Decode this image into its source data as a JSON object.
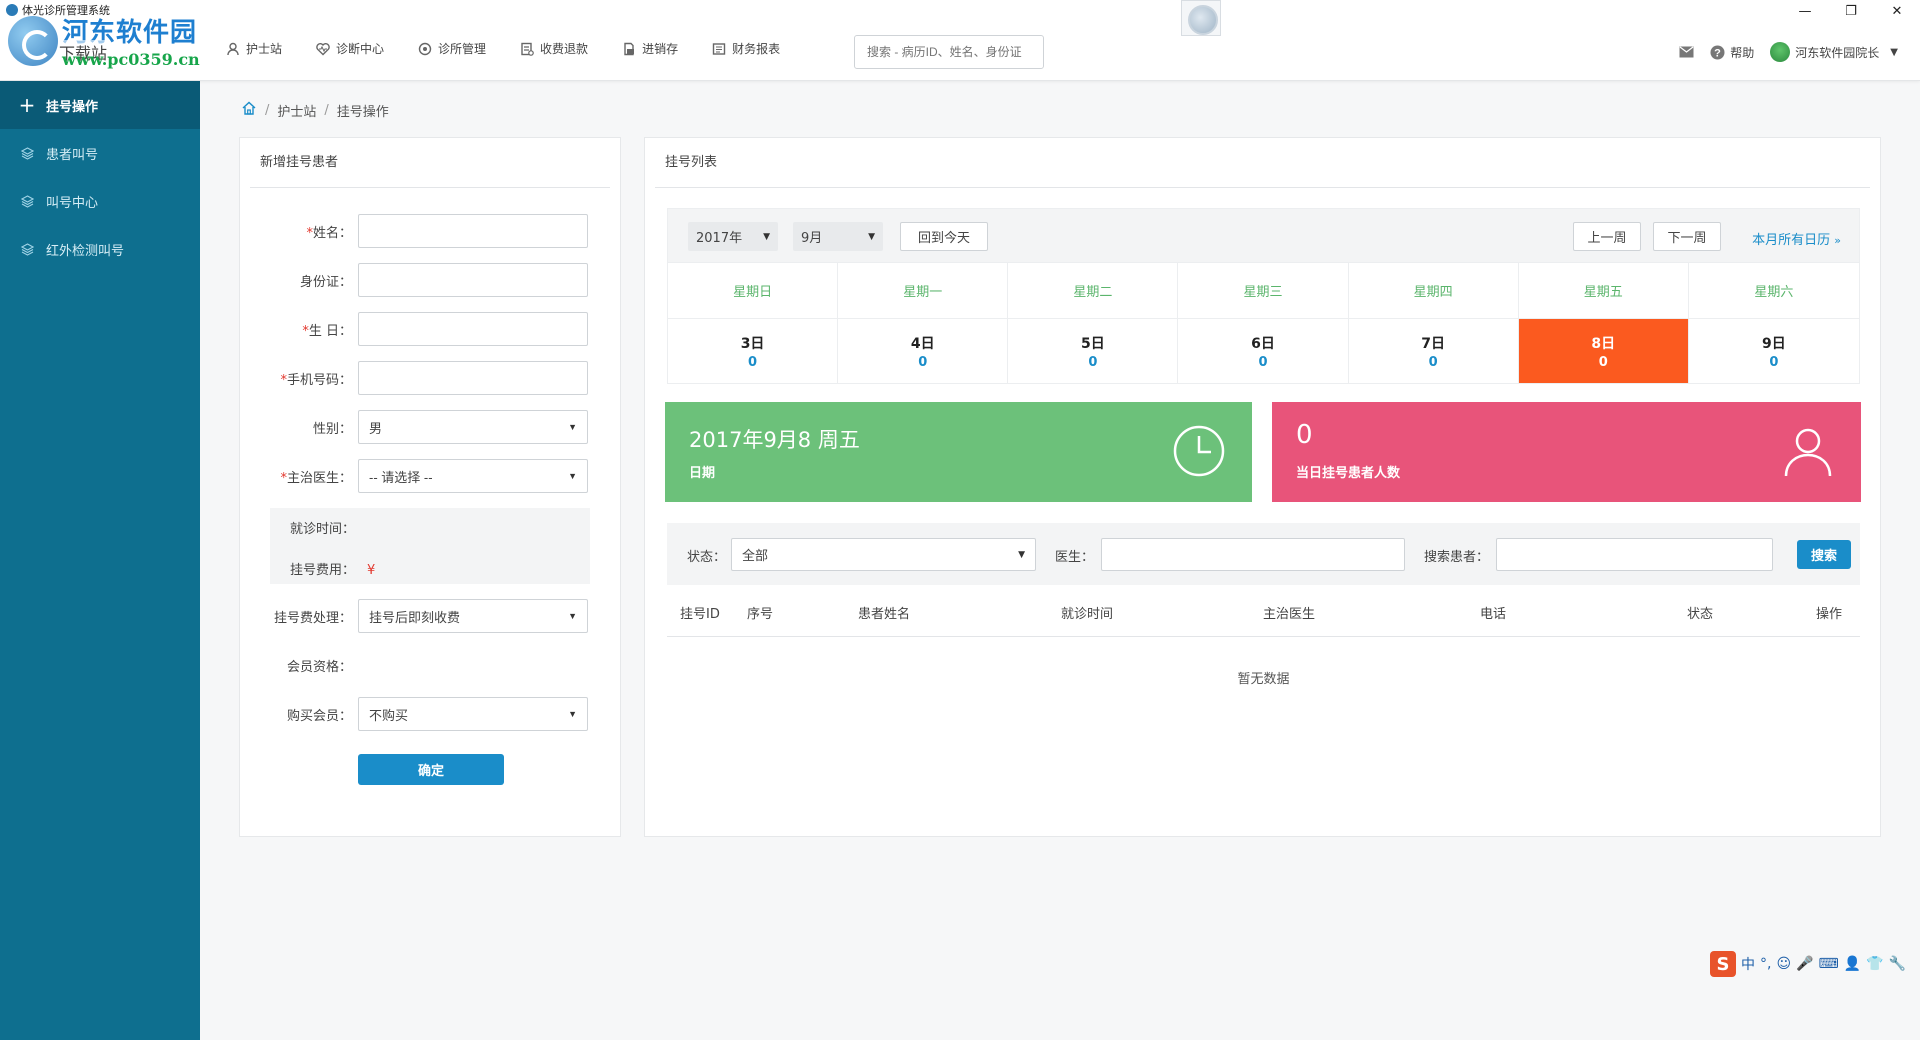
{
  "window": {
    "title": "体光诊所管理系统",
    "controls": [
      "—",
      "❐",
      "✕"
    ]
  },
  "logo": {
    "name": "河东软件园",
    "sub": "www.pc0359.cn",
    "overlay": "下载站"
  },
  "topnav": [
    {
      "label": "护士站",
      "icon": "nurse-icon"
    },
    {
      "label": "诊断中心",
      "icon": "heart-icon"
    },
    {
      "label": "诊所管理",
      "icon": "gear-icon"
    },
    {
      "label": "收费退款",
      "icon": "receipt-icon"
    },
    {
      "label": "进销存",
      "icon": "box-icon"
    },
    {
      "label": "财务报表",
      "icon": "report-icon"
    }
  ],
  "search": {
    "placeholder": "搜索 - 病历ID、姓名、身份证"
  },
  "topright": {
    "help": "帮助",
    "user": "河东软件园院长"
  },
  "sidebar": {
    "items": [
      {
        "label": "挂号操作",
        "active": true
      },
      {
        "label": "患者叫号",
        "active": false
      },
      {
        "label": "叫号中心",
        "active": false
      },
      {
        "label": "红外检测叫号",
        "active": false
      }
    ]
  },
  "breadcrumb": {
    "items": [
      "护士站",
      "挂号操作"
    ],
    "separator": "/"
  },
  "form": {
    "title": "新增挂号患者",
    "name_label": "姓名：",
    "idcard_label": "身份证：",
    "birthday_label": "生 日：",
    "phone_label": "手机号码：",
    "gender_label": "性别：",
    "gender_value": "男",
    "doctor_label": "主治医生：",
    "doctor_value": "-- 请选择 --",
    "visit_time_label": "就诊时间：",
    "fee_label": "挂号费用：",
    "fee_value": "¥",
    "fee_handling_label": "挂号费处理：",
    "fee_handling_value": "挂号后即刻收费",
    "member_label": "会员资格：",
    "buy_member_label": "购买会员：",
    "buy_member_value": "不购买",
    "confirm": "确定",
    "required_mark": "*"
  },
  "list": {
    "title": "挂号列表",
    "year": "2017年",
    "month": "9月",
    "today_btn": "回到今天",
    "prev_week": "上一周",
    "next_week": "下一周",
    "month_all": "本月所有日历",
    "weekdays": [
      "星期日",
      "星期一",
      "星期二",
      "星期三",
      "星期四",
      "星期五",
      "星期六"
    ],
    "days": [
      {
        "day": "3日",
        "count": "0"
      },
      {
        "day": "4日",
        "count": "0"
      },
      {
        "day": "5日",
        "count": "0"
      },
      {
        "day": "6日",
        "count": "0"
      },
      {
        "day": "7日",
        "count": "0"
      },
      {
        "day": "8日",
        "count": "0",
        "today": true
      },
      {
        "day": "9日",
        "count": "0"
      }
    ],
    "date_card": {
      "value": "2017年9月8 周五",
      "label": "日期",
      "color": "#6cc17a"
    },
    "count_card": {
      "value": "0",
      "label": "当日挂号患者人数",
      "color": "#e8547a"
    },
    "filter": {
      "status_label": "状态：",
      "status_value": "全部",
      "doctor_label": "医生：",
      "patient_label": "搜索患者：",
      "search_btn": "搜索"
    },
    "columns": [
      "挂号ID",
      "序号",
      "患者姓名",
      "就诊时间",
      "主治医生",
      "电话",
      "状态",
      "操作"
    ],
    "empty": "暂无数据"
  },
  "ime": {
    "logo": "S",
    "items": [
      "中",
      "°,",
      "☺",
      "🎤",
      "⌨",
      "👤",
      "👕",
      "🔧"
    ]
  },
  "colors": {
    "sidebar": "#0e6f8f",
    "sidebar_active": "#0a5a76",
    "accent": "#1a8dc9",
    "today": "#fb5a1f",
    "weekday": "#5bb56c"
  }
}
